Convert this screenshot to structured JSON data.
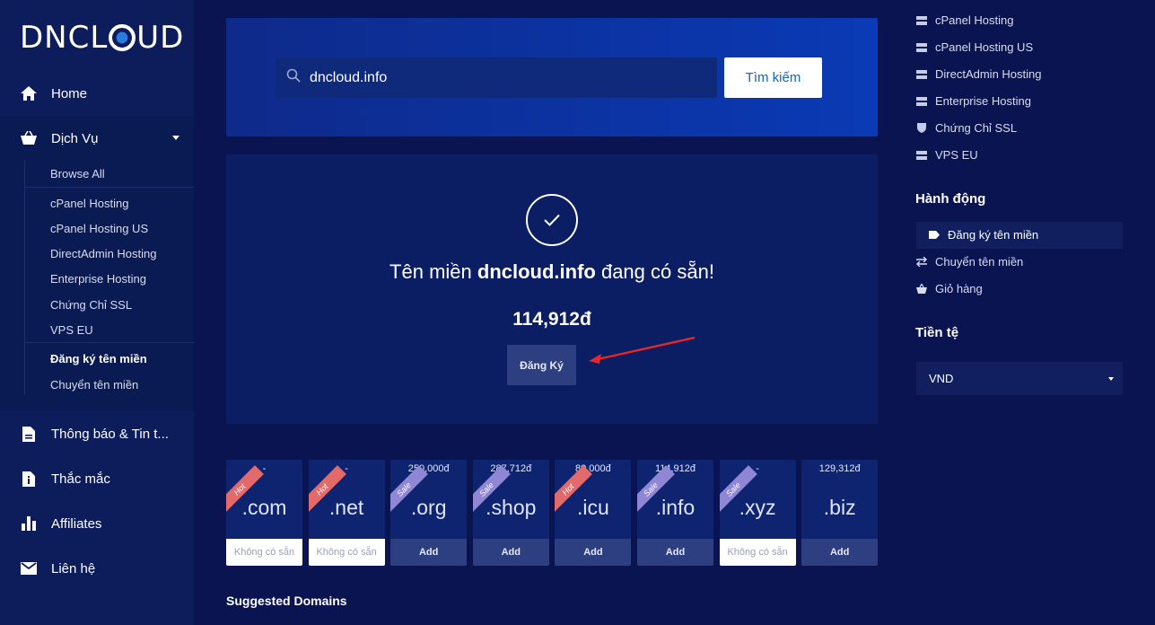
{
  "brand": {
    "logo_text_left": "DNCL",
    "logo_text_right": "UD"
  },
  "sidebar": {
    "items": [
      {
        "label": "Home",
        "icon": "home-icon"
      },
      {
        "label": "Dịch Vụ",
        "icon": "basket-icon"
      },
      {
        "label": "Thông báo & Tin t...",
        "icon": "document-icon"
      },
      {
        "label": "Thắc mắc",
        "icon": "info-file-icon"
      },
      {
        "label": "Affiliates",
        "icon": "bar-chart-icon"
      },
      {
        "label": "Liên hệ",
        "icon": "envelope-icon"
      }
    ],
    "submenu": [
      "Browse All",
      "cPanel Hosting",
      "cPanel Hosting US",
      "DirectAdmin Hosting",
      "Enterprise Hosting",
      "Chứng Chỉ SSL",
      "VPS EU",
      "Đăng ký tên miền",
      "Chuyển tên miền"
    ]
  },
  "search": {
    "value": "dncloud.info",
    "button_label": "Tìm kiếm"
  },
  "result": {
    "title_prefix": "Tên miền ",
    "domain": "dncloud.info",
    "title_suffix": " đang có sẵn!",
    "price": "114,912đ",
    "register_label": "Đăng Ký"
  },
  "tlds": [
    {
      "name": ".com",
      "price": "-",
      "badge": "Hot",
      "action": "Không có sẵn"
    },
    {
      "name": ".net",
      "price": "-",
      "badge": "Hot",
      "action": "Không có sẵn"
    },
    {
      "name": ".org",
      "price": "250,000đ",
      "badge": "Sale",
      "action": "Add"
    },
    {
      "name": ".shop",
      "price": "287,712đ",
      "badge": "Sale",
      "action": "Add"
    },
    {
      "name": ".icu",
      "price": "80,000đ",
      "badge": "Hot",
      "action": "Add"
    },
    {
      "name": ".info",
      "price": "114,912đ",
      "badge": "Sale",
      "action": "Add"
    },
    {
      "name": ".xyz",
      "price": "-",
      "badge": "Sale",
      "action": "Không có sẵn"
    },
    {
      "name": ".biz",
      "price": "129,312đ",
      "badge": "",
      "action": "Add"
    }
  ],
  "suggested_title": "Suggested Domains",
  "right": {
    "categories": [
      "cPanel Hosting",
      "cPanel Hosting US",
      "DirectAdmin Hosting",
      "Enterprise Hosting",
      "Chứng Chỉ SSL",
      "VPS EU"
    ],
    "actions_heading": "Hành động",
    "actions": [
      "Đăng ký tên miền",
      "Chuyển tên miền",
      "Giỏ hàng"
    ],
    "currency_heading": "Tiền tệ",
    "currency_value": "VND"
  },
  "colors": {
    "background": "#0a1450",
    "sidebar": "#0d1d5c",
    "accent": "#0a3ab5",
    "hot": "#e36a6a",
    "sale": "#8f86d6"
  }
}
